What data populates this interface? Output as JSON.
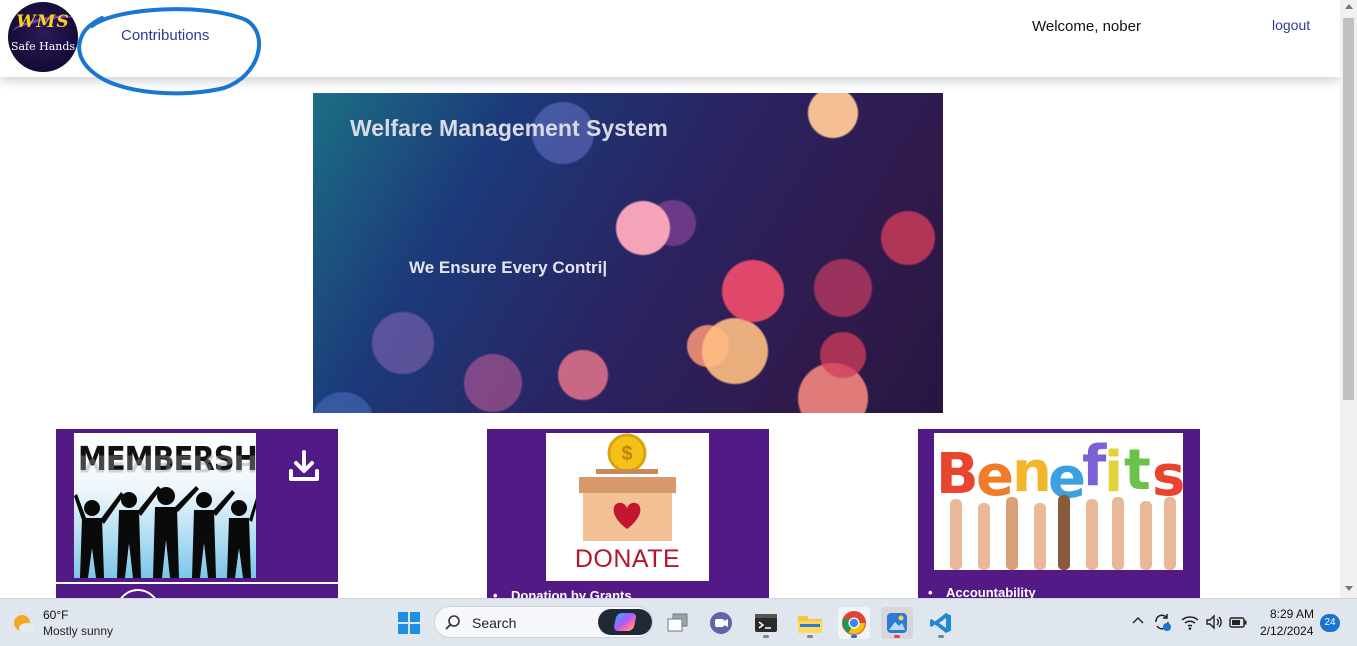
{
  "header": {
    "logo_top": "WMS",
    "logo_bottom": "Safe Hands",
    "nav_link": "Contributions",
    "welcome": "Welcome, nober",
    "logout": "logout"
  },
  "hero": {
    "title": "Welfare Management System",
    "subtitle": "We Ensure Every Contri|"
  },
  "cards": [
    {
      "image_text": "MEMBERSHIP",
      "action_icon": "download-icon"
    },
    {
      "image_text": "DONATE",
      "bullet": "Donation by Grants"
    },
    {
      "image_text": "Benefits",
      "bullet": "Accountability"
    }
  ],
  "colors": {
    "card_bg": "#531a86",
    "link": "#2e3a99",
    "annotation": "#1976d2"
  },
  "taskbar": {
    "weather_temp": "60°F",
    "weather_desc": "Mostly sunny",
    "search_label": "Search",
    "time": "8:29 AM",
    "date": "2/12/2024",
    "notification_count": "24",
    "apps": [
      "start-icon",
      "copilot-icon",
      "task-view-icon",
      "teams-icon",
      "terminal-icon",
      "file-explorer-icon",
      "chrome-icon",
      "photos-icon",
      "vscode-icon"
    ]
  }
}
